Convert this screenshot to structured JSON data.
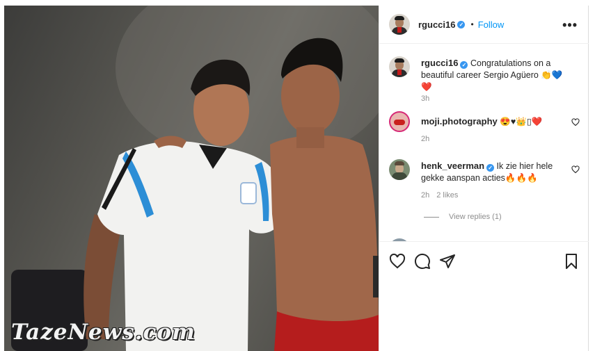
{
  "photo": {
    "watermark": "TazeNews.com",
    "shirt_brand": "adidas"
  },
  "post": {
    "username": "rgucci16",
    "follow_label": "Follow",
    "more_icon": "ellipsis-icon",
    "caption": {
      "username": "rgucci16",
      "text": "Congratulations on a beautiful career Sergio Agüero 👏💙❤️",
      "time": "3h"
    }
  },
  "comments": [
    {
      "username": "moji.photography",
      "text": "😍♥👑▯❤️",
      "time": "2h"
    },
    {
      "username": "henk_veerman",
      "text": "Ik zie hier hele gekke aanspan acties🔥🔥🔥",
      "time": "2h",
      "likes": "2 likes"
    }
  ],
  "view_replies": "View replies (1)",
  "partial_comment": "…",
  "actions": {
    "like_icon": "heart-icon",
    "comment_icon": "comment-icon",
    "share_icon": "paper-plane-icon",
    "save_icon": "bookmark-icon"
  },
  "colors": {
    "accent": "#0095f6",
    "verified": "#3897f0",
    "muted": "#8e8e8e"
  }
}
